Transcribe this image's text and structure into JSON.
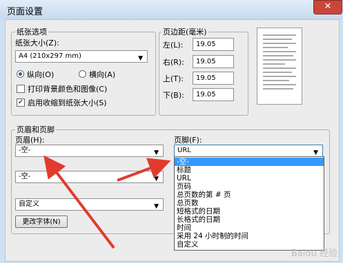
{
  "window": {
    "title": "页面设置",
    "close_label": "✕"
  },
  "paper": {
    "group_label": "纸张选项",
    "size_label": "纸张大小(Z):",
    "size_value": "A4 (210x297 mm)",
    "portrait_label": "纵向(O)",
    "landscape_label": "横向(A)",
    "orientation_selected": "portrait",
    "print_bg_label": "打印背景颜色和图像(C)",
    "print_bg_checked": false,
    "shrink_label": "启用收缩到纸张大小(S)",
    "shrink_checked": true
  },
  "margins": {
    "group_label": "页边距(毫米)",
    "left_label": "左(L):",
    "left_value": "19.05",
    "right_label": "右(R):",
    "right_value": "19.05",
    "top_label": "上(T):",
    "top_value": "19.05",
    "bottom_label": "下(B):",
    "bottom_value": "19.05"
  },
  "hf": {
    "group_label": "页眉和页脚",
    "header_label": "页眉(H):",
    "header_value1": "-空-",
    "header_value2": "-空-",
    "header_value3": "自定义",
    "footer_label": "页脚(F):",
    "footer_value": "URL",
    "font_button": "更改字体(N)"
  },
  "dropdown": {
    "items": [
      "-空-",
      "标题",
      "URL",
      "页码",
      "总页数的第 # 页",
      "总页数",
      "短格式的日期",
      "长格式的日期",
      "时间",
      "采用 24 小时制的时间",
      "自定义"
    ],
    "selected_index": 0
  },
  "watermark": "Baidu 经验"
}
